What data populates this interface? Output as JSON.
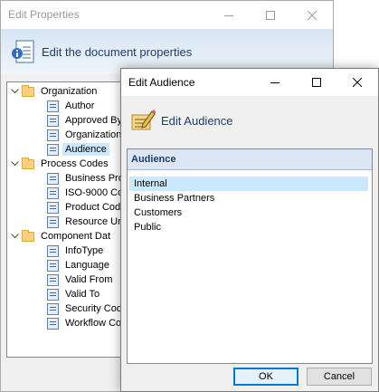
{
  "props_window": {
    "title": "Edit Properties",
    "header_title": "Edit the document properties",
    "tree": [
      {
        "label": "Organization",
        "type": "group",
        "expanded": true
      },
      {
        "label": "Author",
        "type": "item"
      },
      {
        "label": "Approved By",
        "type": "item"
      },
      {
        "label": "Organization",
        "type": "item"
      },
      {
        "label": "Audience",
        "type": "item",
        "selected": true
      },
      {
        "label": "Process Codes",
        "type": "group",
        "expanded": true
      },
      {
        "label": "Business Pro",
        "type": "item"
      },
      {
        "label": "ISO-9000 Co",
        "type": "item"
      },
      {
        "label": "Product Cod",
        "type": "item"
      },
      {
        "label": "Resource Ur",
        "type": "item"
      },
      {
        "label": "Component Dat",
        "type": "group",
        "expanded": true
      },
      {
        "label": "InfoType",
        "type": "item"
      },
      {
        "label": "Language",
        "type": "item"
      },
      {
        "label": "Valid From",
        "type": "item"
      },
      {
        "label": "Valid To",
        "type": "item"
      },
      {
        "label": "Security Cod",
        "type": "item"
      },
      {
        "label": "Workflow Co",
        "type": "item"
      }
    ]
  },
  "audience_dialog": {
    "title": "Edit Audience",
    "header_title": "Edit Audience",
    "list_header": "Audience",
    "items": [
      "Internal",
      "Business Partners",
      "Customers",
      "Public"
    ],
    "selected_index": 0,
    "ok_label": "OK",
    "cancel_label": "Cancel"
  },
  "icons": {
    "minimize": "minimize-icon",
    "maximize": "maximize-icon",
    "close": "close-icon",
    "folder": "folder-icon",
    "property": "property-icon",
    "document_info": "document-info-icon",
    "edit": "edit-pencil-icon",
    "expand": "chevron-down-icon"
  },
  "colors": {
    "selection": "#cce8ff",
    "accent": "#0078d7",
    "header_band": "#d7e5f4",
    "list_header": "#dce6f4"
  }
}
